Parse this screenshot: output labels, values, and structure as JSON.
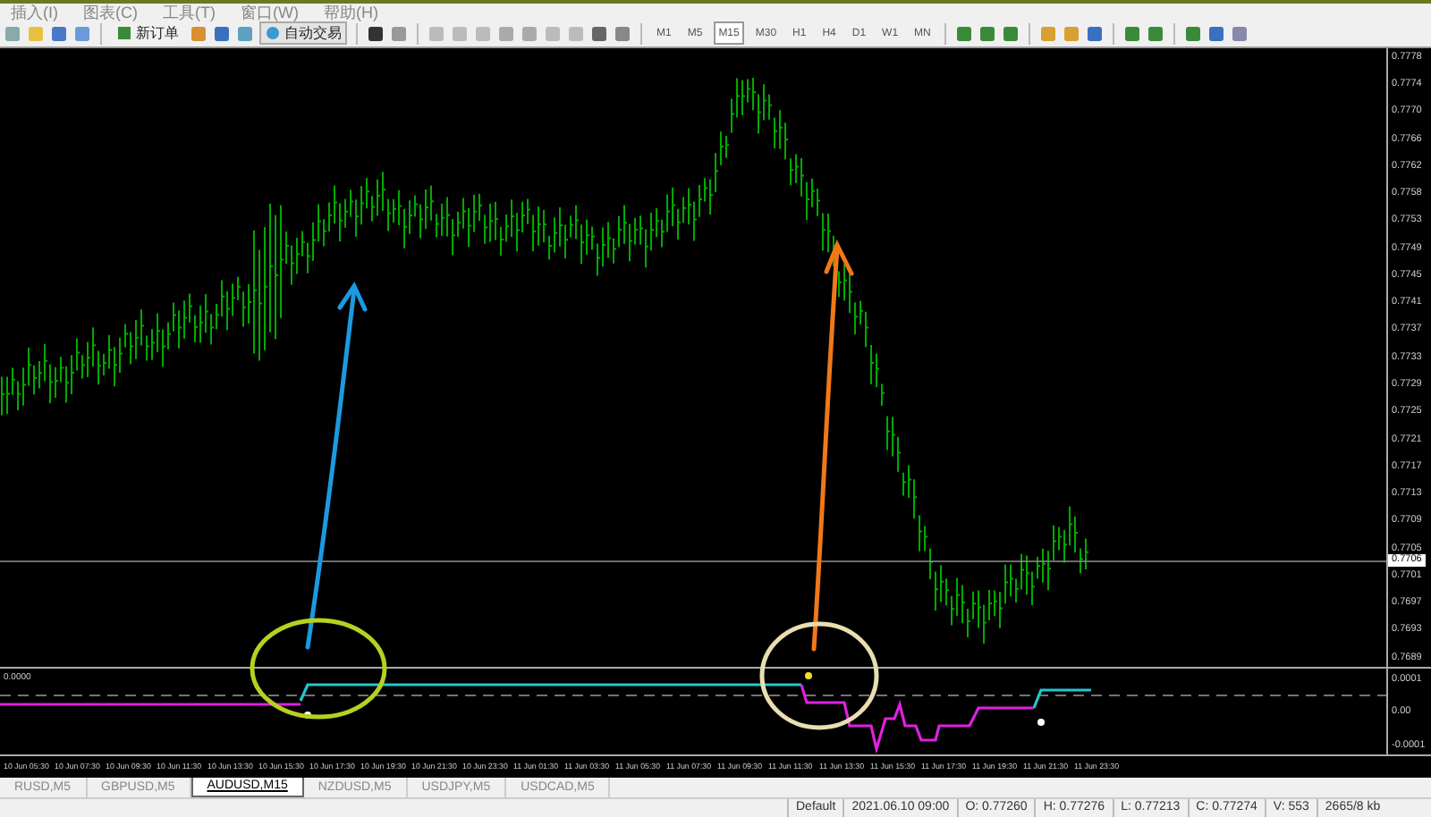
{
  "menu": [
    "插入(I)",
    "图表(C)",
    "工具(T)",
    "窗口(W)",
    "帮助(H)"
  ],
  "toolbar": {
    "buttons": [
      {
        "label": "新订单"
      },
      {
        "label": "自动交易"
      }
    ],
    "timeframes": [
      {
        "label": "M1",
        "selected": false
      },
      {
        "label": "M5",
        "selected": false
      },
      {
        "label": "M15",
        "selected": true
      },
      {
        "label": "M30",
        "selected": false
      },
      {
        "label": "H1",
        "selected": false
      },
      {
        "label": "H4",
        "selected": false
      },
      {
        "label": "D1",
        "selected": false
      },
      {
        "label": "W1",
        "selected": false
      },
      {
        "label": "MN",
        "selected": false
      }
    ]
  },
  "price_axis": {
    "labels": [
      "0.7778",
      "0.7774",
      "0.7770",
      "0.7766",
      "0.7762",
      "0.7758",
      "0.7753",
      "0.7749",
      "0.7745",
      "0.7741",
      "0.7737",
      "0.7733",
      "0.7729",
      "0.7725",
      "0.7721",
      "0.7717",
      "0.7713",
      "0.7709",
      "0.7705",
      "0.7701",
      "0.7697",
      "0.7693",
      "0.7689"
    ],
    "current_price": "0.7706"
  },
  "indicator": {
    "label": "0.0000",
    "axis": [
      "0.0001",
      "0.00",
      "-0.0001"
    ]
  },
  "time_axis": [
    "10 Jun 05:30",
    "10 Jun 07:30",
    "10 Jun 09:30",
    "10 Jun 11:30",
    "10 Jun 13:30",
    "10 Jun 15:30",
    "10 Jun 17:30",
    "10 Jun 19:30",
    "10 Jun 21:30",
    "10 Jun 23:30",
    "11 Jun 01:30",
    "11 Jun 03:30",
    "11 Jun 05:30",
    "11 Jun 07:30",
    "11 Jun 09:30",
    "11 Jun 11:30",
    "11 Jun 13:30",
    "11 Jun 15:30",
    "11 Jun 17:30",
    "11 Jun 19:30",
    "11 Jun 21:30",
    "11 Jun 23:30"
  ],
  "tabs": [
    {
      "label": "RUSD,M5",
      "selected": false
    },
    {
      "label": "GBPUSD,M5",
      "selected": false
    },
    {
      "label": "AUDUSD,M15",
      "selected": true
    },
    {
      "label": "NZDUSD,M5",
      "selected": false
    },
    {
      "label": "USDJPY,M5",
      "selected": false
    },
    {
      "label": "USDCAD,M5",
      "selected": false
    }
  ],
  "status_bar": [
    "Default",
    "2021.06.10 09:00",
    "O: 0.77260",
    "H: 0.77276",
    "L: 0.77213",
    "C: 0.77274",
    "V: 553",
    "2665/8 kb"
  ]
}
